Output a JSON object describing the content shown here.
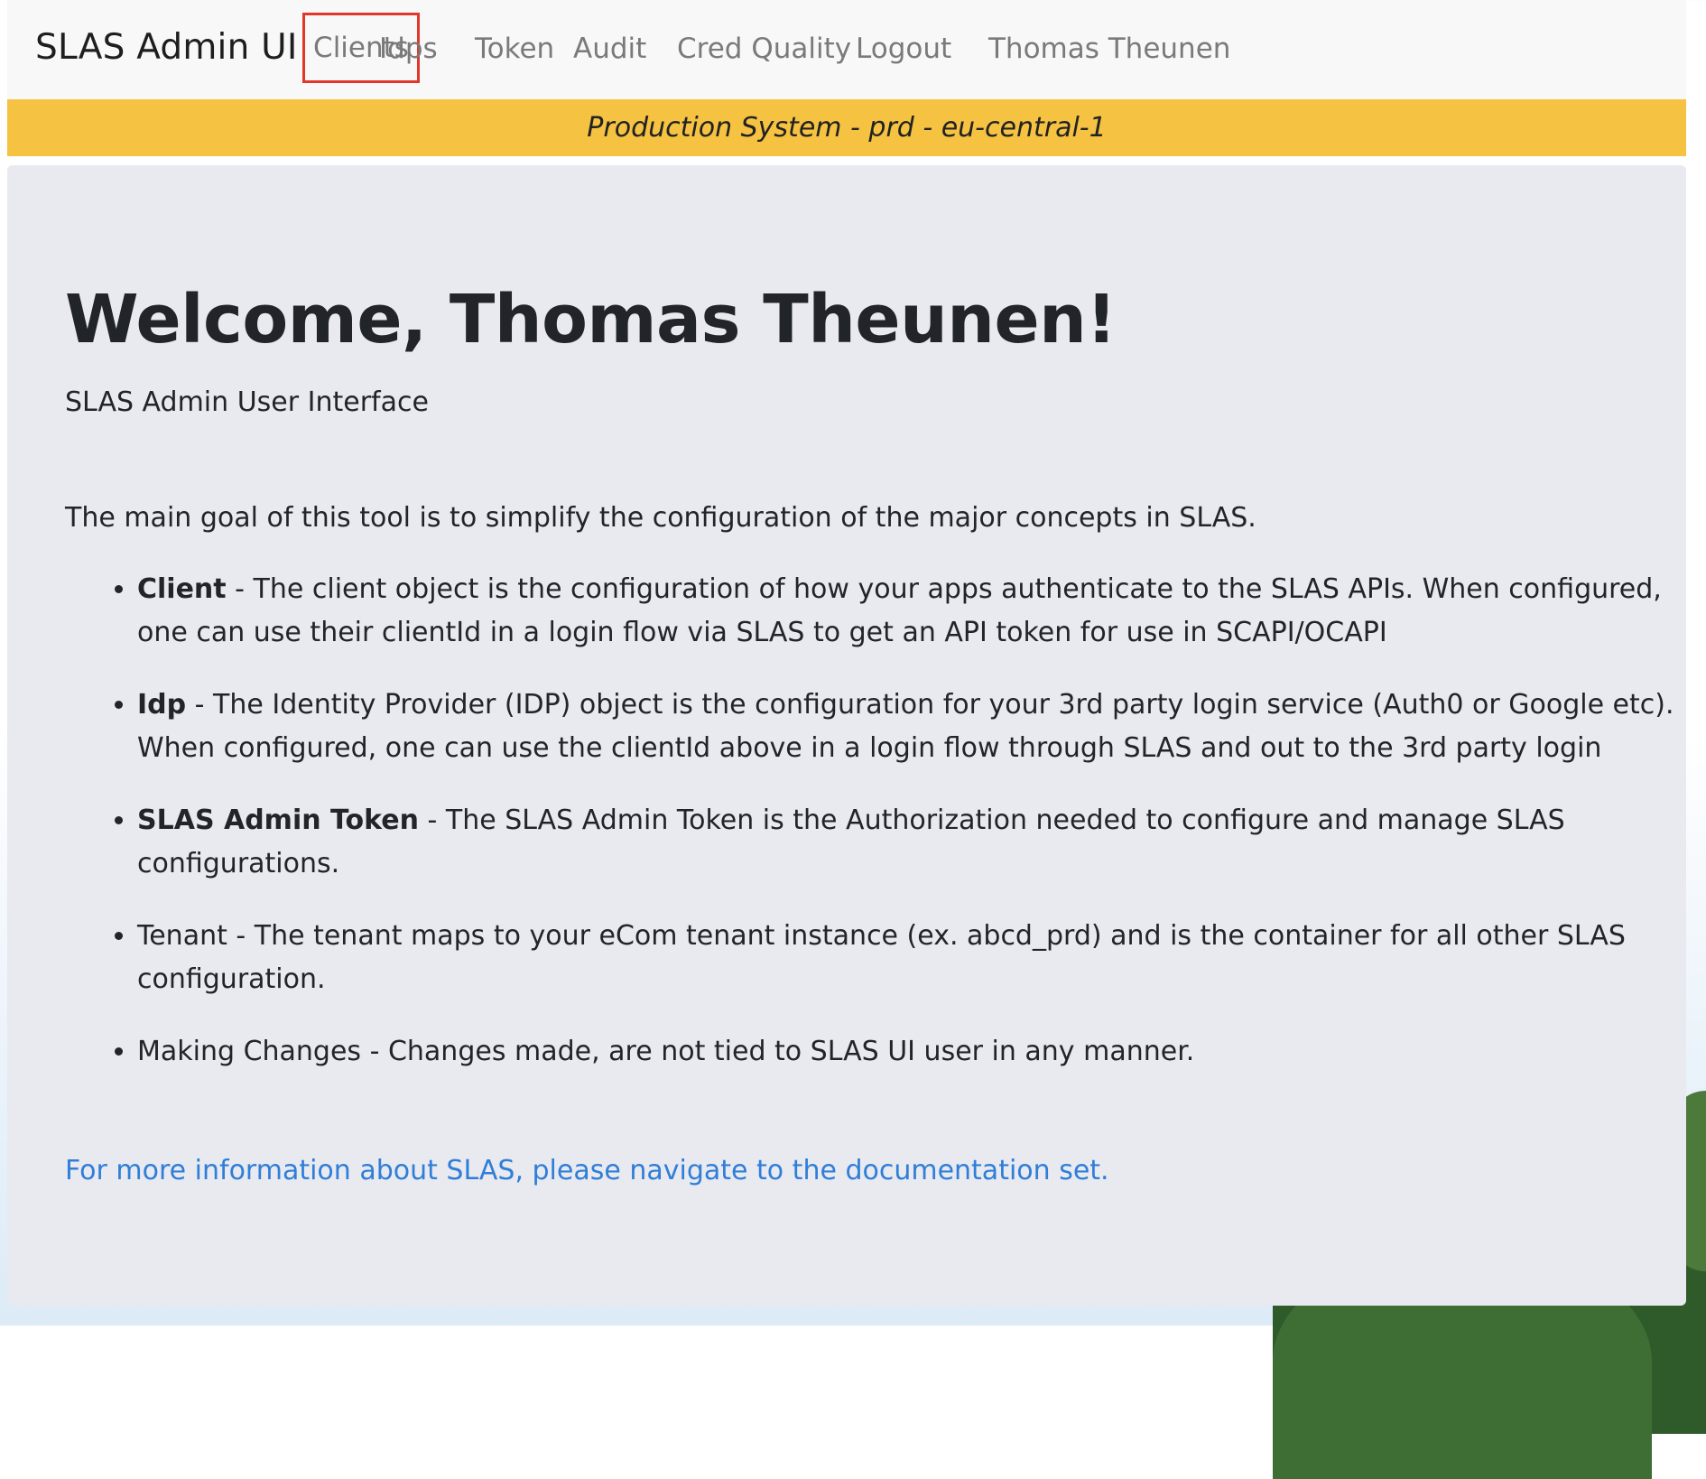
{
  "navbar": {
    "brand": "SLAS Admin UI",
    "items": [
      {
        "label": "Clients",
        "highlighted": true
      },
      {
        "label": "Idps"
      },
      {
        "label": "Token"
      },
      {
        "label": "Audit"
      },
      {
        "label": "Cred Quality"
      },
      {
        "label": "Logout"
      },
      {
        "label": "Thomas Theunen"
      }
    ]
  },
  "environment": {
    "banner": "Production System - prd - eu-central-1",
    "color": "#f5c242"
  },
  "main": {
    "title": "Welcome, Thomas Theunen!",
    "subtitle": "SLAS Admin User Interface",
    "intro": "The main goal of this tool is to simplify the configuration of the major concepts in SLAS.",
    "concepts": [
      {
        "term": "Client",
        "bold": true,
        "text": " - The client object is the configuration of how your apps authenticate to the SLAS APIs. When configured, one can use their clientId in a login flow via SLAS to get an API token for use in SCAPI/OCAPI"
      },
      {
        "term": "Idp",
        "bold": true,
        "text": " - The Identity Provider (IDP) object is the configuration for your 3rd party login service (Auth0 or Google etc). When configured, one can use the clientId above in a login flow through SLAS and out to the 3rd party login"
      },
      {
        "term": "SLAS Admin Token",
        "bold": true,
        "text": " - The SLAS Admin Token is the Authorization needed to configure and manage SLAS configurations."
      },
      {
        "term": "Tenant",
        "bold": false,
        "text": " - The tenant maps to your eCom tenant instance (ex. abcd_prd) and is the container for all other SLAS configuration."
      },
      {
        "term": "Making Changes",
        "bold": false,
        "text": " - Changes made, are not tied to SLAS UI user in any manner."
      }
    ],
    "doc_link": "For more information about SLAS, please navigate to the documentation set."
  },
  "colors": {
    "highlight_border": "#e2362b",
    "link": "#2f7ed8",
    "content_bg": "#e9e9f0"
  }
}
